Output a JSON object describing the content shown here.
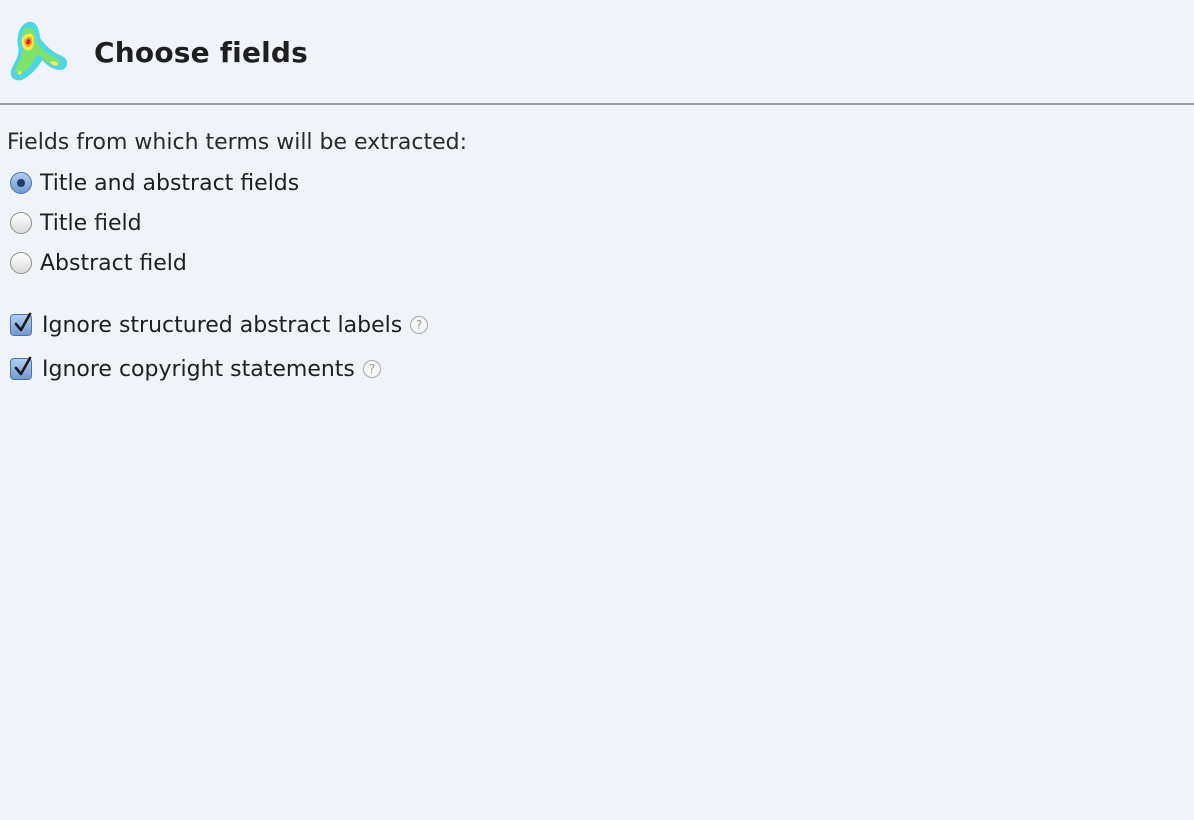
{
  "header": {
    "title": "Choose fields",
    "logo_icon": "heatmap-logo-icon"
  },
  "fields": {
    "section_label": "Fields from which terms will be extracted:",
    "options": [
      {
        "label": "Title and abstract fields",
        "selected": true
      },
      {
        "label": "Title field",
        "selected": false
      },
      {
        "label": "Abstract field",
        "selected": false
      }
    ]
  },
  "checkboxes": [
    {
      "label": "Ignore structured abstract labels",
      "checked": true,
      "help_icon": "help-icon"
    },
    {
      "label": "Ignore copyright statements",
      "checked": true,
      "help_icon": "help-icon"
    }
  ],
  "colors": {
    "background": "#f0f4f9",
    "accent": "#6e9bd4",
    "divider": "#9b9b9b"
  }
}
